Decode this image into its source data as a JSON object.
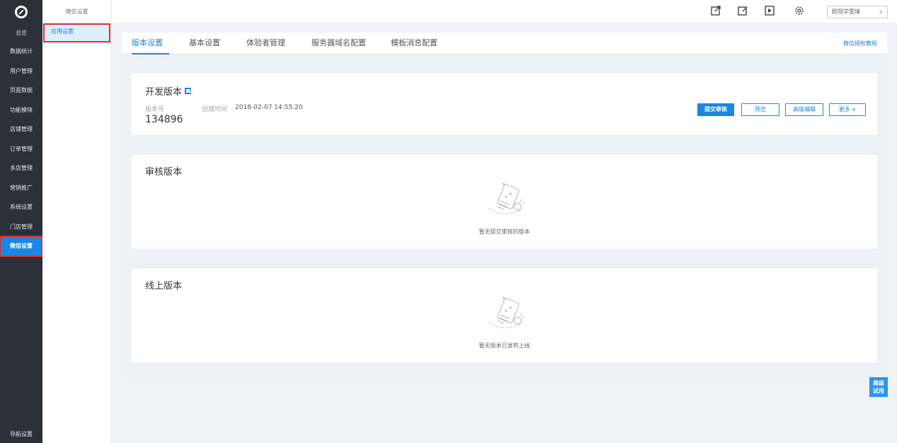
{
  "nav": {
    "home": "总览",
    "items": [
      "数据统计",
      "用户管理",
      "页面数据",
      "功能模块",
      "店铺管理",
      "订单管理",
      "多店管理",
      "营销推广",
      "系统设置",
      "门店管理",
      "微信设置"
    ],
    "bottom": "导航设置"
  },
  "subnav": {
    "title": "微信设置",
    "item": "应用设置"
  },
  "topbar": {
    "user": "欧阳学雷锋"
  },
  "tabs": {
    "items": [
      "版本设置",
      "基本设置",
      "体验者管理",
      "服务器域名配置",
      "模板消息配置"
    ],
    "link": "微信授权教程"
  },
  "dev": {
    "title": "开发版本",
    "version_label": "版本号",
    "version": "134896",
    "created_label": "创建时间",
    "created": "2018-02-07 14:55:20",
    "buttons": {
      "submit": "提交审核",
      "preview": "预览",
      "advanced_edit": "高级编辑",
      "more": "更多 ∨"
    }
  },
  "review": {
    "title": "审核版本",
    "empty": "暂无提交审核的版本"
  },
  "online": {
    "title": "线上版本",
    "empty": "暂无版本已发布上线"
  },
  "float": {
    "line1": "高级",
    "line2": "试用"
  },
  "colors": {
    "accent": "#1b86e3",
    "nav_bg": "#2b3039",
    "highlight": "#e12e2e"
  }
}
